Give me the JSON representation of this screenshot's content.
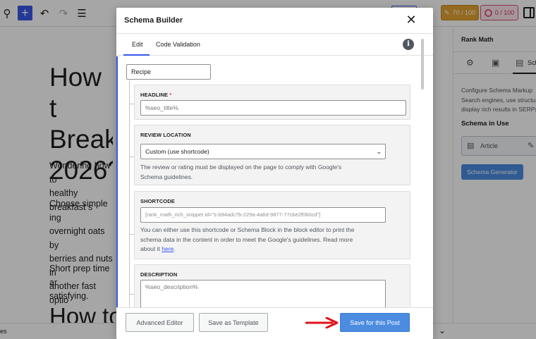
{
  "toolbar": {
    "seo_score": "70 / 100",
    "readability_score": "0 / 100"
  },
  "editor": {
    "title": "How t\nBreakf\n2026?",
    "para1": "Wondering how to\nhealthy breakfast s",
    "para2": "Choose simple ing\novernight oats by\nberries and nuts in\nanother fast optio",
    "para3": "Short prep time ar\nsatisfying.",
    "heading2": "How to",
    "status_crumb": "es"
  },
  "sidebar": {
    "title": "Rank Math",
    "tab_label": "Sche",
    "description": "Configure Schema Markup\nSearch engines, use structu\ndisplay rich results in SERPs",
    "in_use_heading": "Schema in Use",
    "in_use_item": "Article",
    "generator_button": "Schema Generator"
  },
  "modal": {
    "title": "Schema Builder",
    "tabs": [
      "Edit",
      "Code Validation"
    ],
    "schema_type": "Recipe",
    "fields": {
      "headline": {
        "label": "HEADLINE",
        "required_mark": "*",
        "value": "%seo_title%"
      },
      "review_location": {
        "label": "REVIEW LOCATION",
        "value": "Custom (use shortcode)",
        "help": "The review or rating must be displayed on the page to comply with Google's\nSchema guidelines."
      },
      "shortcode": {
        "label": "SHORTCODE",
        "value": "[rank_math_rich_snippet id=\"s-b94adc7b-229a-4a6d-9877-77cbe2f0b0cd\"]",
        "help_main": "You can either use this shortcode or Schema Block in the block editor to print the\nschema data in the content in order to meet the Google's guidelines. Read more\nabout it ",
        "help_link": "here",
        "help_end": "."
      },
      "description": {
        "label": "DESCRIPTION",
        "value": "%seo_description%"
      }
    },
    "footer": {
      "advanced_editor": "Advanced Editor",
      "save_template": "Save as Template",
      "save_post": "Save for this Post"
    }
  },
  "colors": {
    "accent": "#3858e9",
    "save_button": "#4b8ce0",
    "arrow": "#e0121b",
    "seo_pill": "#e4a432",
    "readability_pill": "#d94d75"
  }
}
